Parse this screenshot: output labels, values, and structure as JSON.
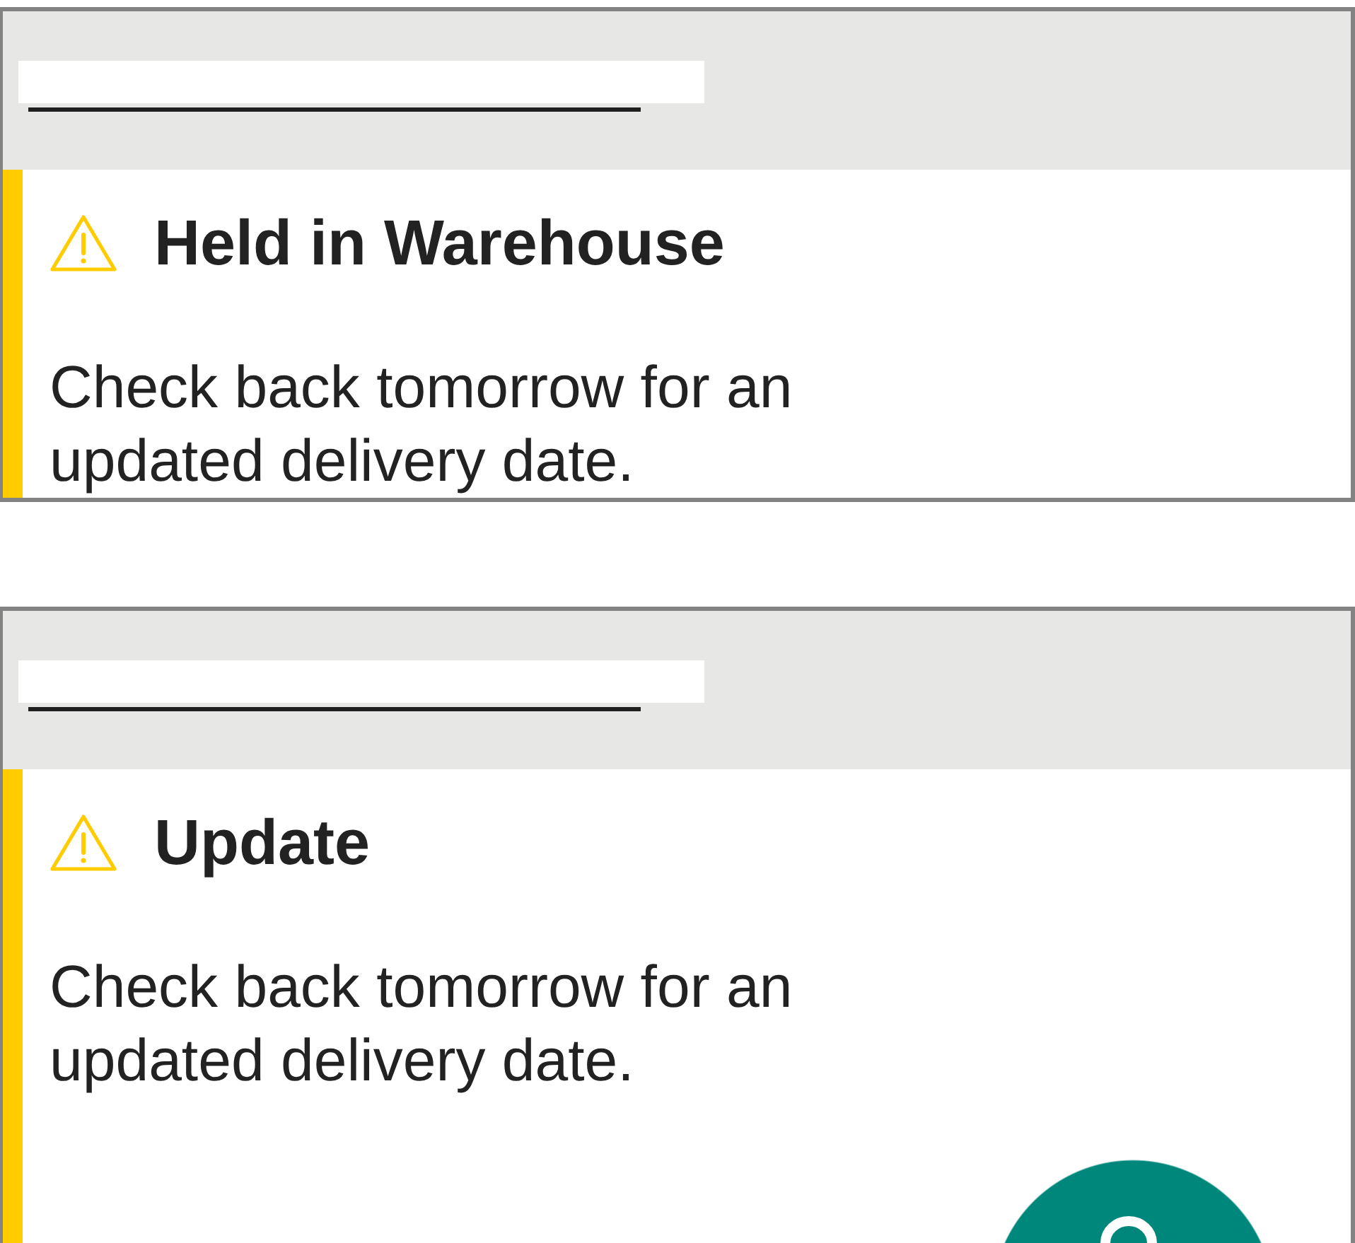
{
  "shipments": [
    {
      "tracking_number_redacted": true,
      "notice": {
        "kind": "warning",
        "title": "Held in Warehouse",
        "message": "Check back tomorrow for an updated delivery date."
      }
    },
    {
      "tracking_number_redacted": true,
      "notice": {
        "kind": "warning",
        "title": "Update",
        "message": "Check back tomorrow for an updated delivery date."
      }
    }
  ],
  "help_button": {
    "shown": true
  }
}
